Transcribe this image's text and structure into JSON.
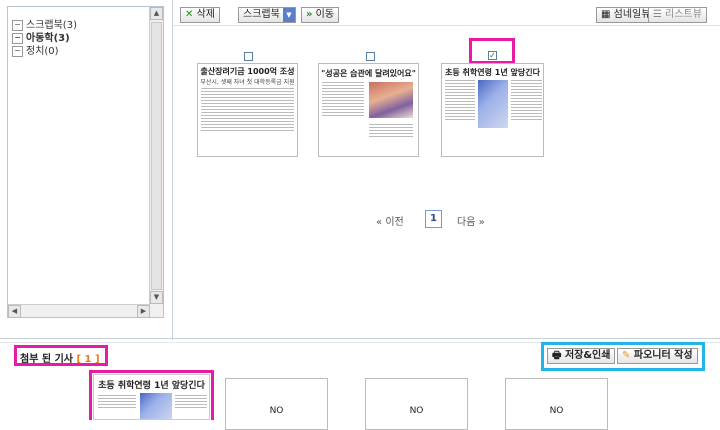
{
  "tree": {
    "items": [
      {
        "label": "스크랩북(3)",
        "icon": "minus-box-icon"
      },
      {
        "label": "아동학(3)",
        "icon": "minus-box-icon"
      },
      {
        "label": "정치(0)",
        "icon": "minus-box-icon"
      }
    ]
  },
  "toolbar": {
    "delete_label": "삭제",
    "folder_select": "스크랩북",
    "move_label": "이동",
    "thumb_view_label": "섬네일뷰",
    "list_view_label": "리스트뷰"
  },
  "articles": [
    {
      "title": "출산장려기금 1000억 조성",
      "subtitle": "부산시, 셋째 자녀 첫 대학등록금 지원",
      "checked": false
    },
    {
      "title": "\"성공은 습관에 달려있어요\"",
      "checked": false
    },
    {
      "title": "초등 취학연령 1년 앞당긴다",
      "checked": true
    }
  ],
  "pagination": {
    "prev": "이전",
    "current": "1",
    "next": "다음"
  },
  "attached": {
    "label": "첨부 된 기사",
    "count": "1",
    "save_print_label": "저장&인쇄",
    "writer_label": "파오니터 작성",
    "first_title": "초등 취학연령 1년 앞당긴다",
    "empty_labels": [
      "NO",
      "NO",
      "NO"
    ]
  },
  "colors": {
    "highlight_magenta": "#e81aa6",
    "highlight_cyan": "#22b5e8"
  }
}
